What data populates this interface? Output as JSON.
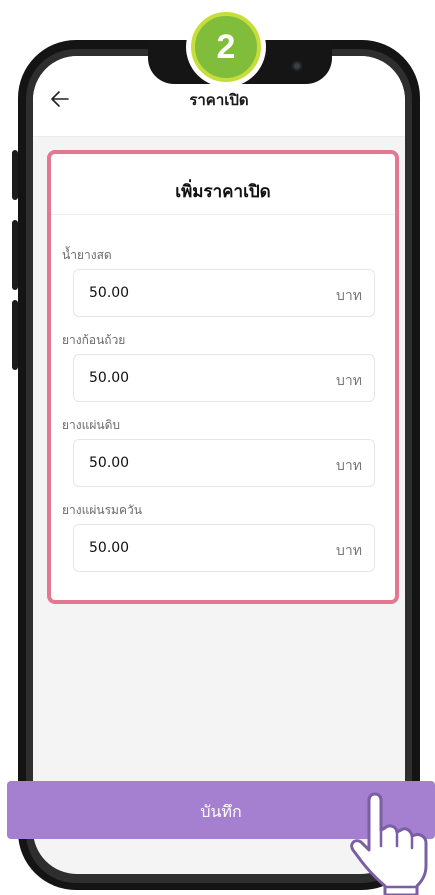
{
  "step_badge": {
    "number": "2"
  },
  "header": {
    "title": "ราคาเปิด",
    "back_icon": "arrow-left-icon"
  },
  "dialog": {
    "title": "เพิ่มราคาเปิด",
    "fields": [
      {
        "label": "น้ำยางสด",
        "value": "50.00",
        "unit": "บาท"
      },
      {
        "label": "ยางก้อนถ้วย",
        "value": "50.00",
        "unit": "บาท"
      },
      {
        "label": "ยางแผ่นดิบ",
        "value": "50.00",
        "unit": "บาท"
      },
      {
        "label": "ยางแผ่นรมควัน",
        "value": "50.00",
        "unit": "บาท"
      }
    ]
  },
  "actions": {
    "save_label": "บันทึก",
    "pointer_icon": "hand-pointer-icon"
  },
  "colors": {
    "accent_purple": "#a57fd0",
    "highlight_pink": "#e47791",
    "badge_green": "#7fbd3a",
    "badge_ring": "#c7dd3c"
  }
}
